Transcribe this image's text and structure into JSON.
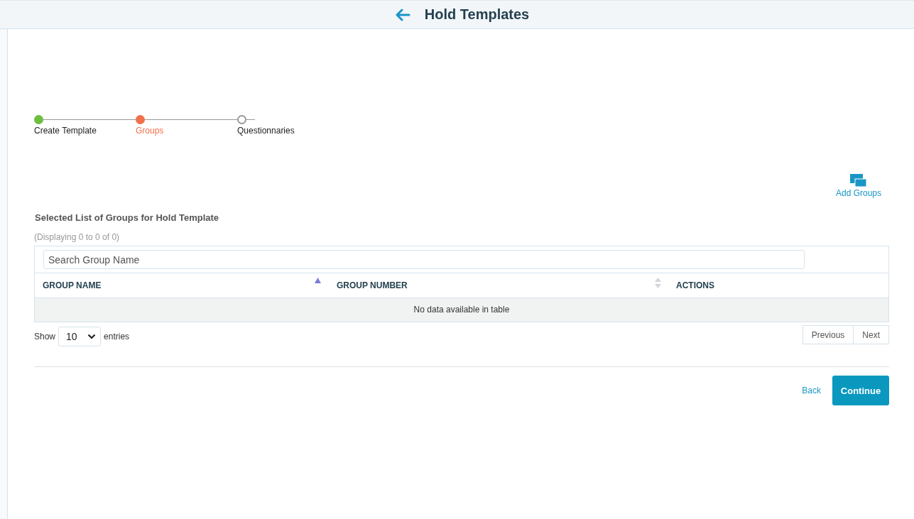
{
  "header": {
    "title": "Hold Templates"
  },
  "steps": [
    {
      "label": "Create Template",
      "completed": true,
      "selected": false
    },
    {
      "label": "Groups",
      "completed": false,
      "selected": true
    },
    {
      "label": "Questionnaries",
      "completed": false,
      "selected": false
    }
  ],
  "add_button": {
    "label": "Add Groups"
  },
  "section": {
    "title": "Selected List of Groups for Hold Template",
    "info": "(Displaying 0 to 0 of 0)"
  },
  "search": {
    "placeholder": "Search Group Name"
  },
  "table": {
    "columns": [
      {
        "label": "GROUP NAME",
        "kind": "sortable",
        "sorted": true
      },
      {
        "label": "GROUP NUMBER",
        "kind": "sortable",
        "sorted": false
      },
      {
        "label": "ACTIONS",
        "kind": "plain"
      }
    ],
    "empty_message": "No data available in table"
  },
  "length": {
    "before": "Show",
    "value": "10",
    "after": "entries"
  },
  "pager": [
    "Previous",
    "Next"
  ],
  "footer": {
    "back": "Back",
    "continue": "Continue"
  }
}
